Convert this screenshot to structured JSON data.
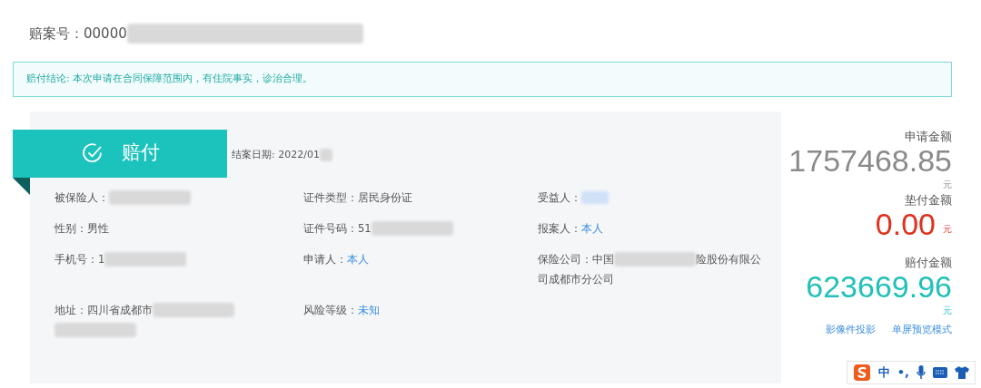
{
  "case_number": {
    "label": "赔案号：",
    "value": "00000",
    "redacted": true
  },
  "conclusion": "赔付结论: 本次申请在合同保障范围内，有住院事实，诊治合理。",
  "result": {
    "title": "赔付",
    "date_label": "结案日期: 2022/01",
    "date_redacted": true
  },
  "fields": [
    {
      "segments": [
        {
          "kind": "label",
          "text": "被保险人："
        },
        {
          "kind": "blur"
        }
      ]
    },
    {
      "segments": [
        {
          "kind": "label",
          "text": "证件类型："
        },
        {
          "kind": "text",
          "text": "居民身份证"
        }
      ]
    },
    {
      "segments": [
        {
          "kind": "label",
          "text": "受益人："
        },
        {
          "kind": "blur_link"
        }
      ]
    },
    {
      "segments": [
        {
          "kind": "label",
          "text": "性别："
        },
        {
          "kind": "text",
          "text": "男性"
        }
      ]
    },
    {
      "segments": [
        {
          "kind": "label",
          "text": "证件号码："
        },
        {
          "kind": "text",
          "text": "51"
        },
        {
          "kind": "blur"
        }
      ]
    },
    {
      "segments": [
        {
          "kind": "label",
          "text": "报案人："
        },
        {
          "kind": "link",
          "text": "本人"
        }
      ]
    },
    {
      "segments": [
        {
          "kind": "label",
          "text": "手机号："
        },
        {
          "kind": "text",
          "text": "1"
        },
        {
          "kind": "blur"
        }
      ]
    },
    {
      "segments": [
        {
          "kind": "label",
          "text": "申请人："
        },
        {
          "kind": "link",
          "text": "本人"
        }
      ]
    },
    {
      "segments": [
        {
          "kind": "label",
          "text": "保险公司："
        },
        {
          "kind": "text",
          "text": "中国"
        },
        {
          "kind": "blur"
        },
        {
          "kind": "text",
          "text": "险股份有限公"
        },
        {
          "kind": "break"
        },
        {
          "kind": "text",
          "text": "司成都市分公司"
        }
      ]
    },
    {
      "segments": [
        {
          "kind": "label",
          "text": "地址："
        },
        {
          "kind": "text",
          "text": "四川省成都市"
        },
        {
          "kind": "blur"
        },
        {
          "kind": "break"
        },
        {
          "kind": "blur"
        }
      ]
    },
    {
      "segments": [
        {
          "kind": "label",
          "text": "风险等级："
        },
        {
          "kind": "link",
          "text": "未知"
        }
      ]
    }
  ],
  "amounts": [
    {
      "label": "申请金额",
      "value": "1757468.85",
      "unit": "元",
      "color": "#8a8a8a",
      "unit_inline": false
    },
    {
      "label": "垫付金额",
      "value": "0.00",
      "unit": "元",
      "color": "#e0301e",
      "unit_inline": true
    },
    {
      "label": "赔付金额",
      "value": "623669.96",
      "unit": "元",
      "color": "#22c0b8",
      "unit_inline": false
    }
  ],
  "links": [
    "影像件投影",
    "单屏预览模式"
  ],
  "ime_toolbar": [
    "中",
    "•,"
  ]
}
